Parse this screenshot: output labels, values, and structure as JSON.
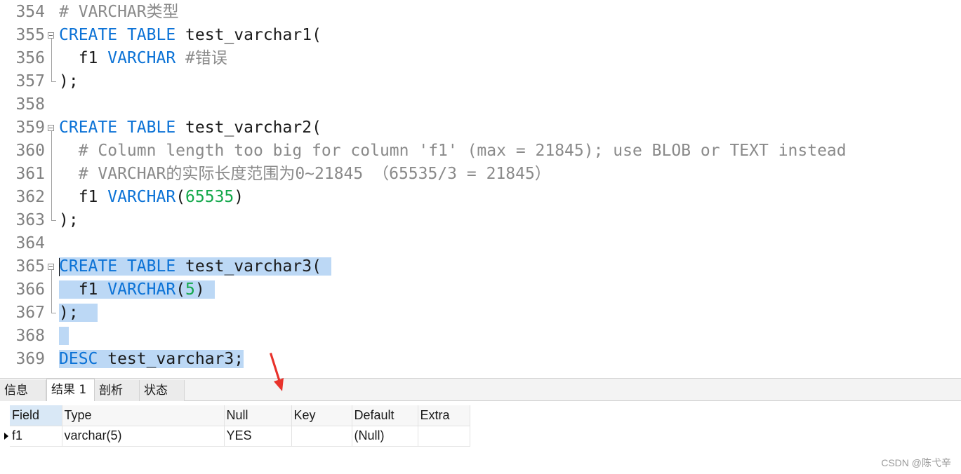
{
  "editor": {
    "lines": [
      {
        "num": "354",
        "parts": [
          {
            "t": "# VARCHAR类型",
            "c": "cm"
          }
        ]
      },
      {
        "num": "355",
        "parts": [
          {
            "t": "CREATE",
            "c": "kw"
          },
          {
            "t": " "
          },
          {
            "t": "TABLE",
            "c": "kw"
          },
          {
            "t": " test_varchar1("
          }
        ]
      },
      {
        "num": "356",
        "parts": [
          {
            "t": "  f1 "
          },
          {
            "t": "VARCHAR",
            "c": "kw"
          },
          {
            "t": " #错误",
            "c": "cm"
          }
        ]
      },
      {
        "num": "357",
        "parts": [
          {
            "t": ");"
          }
        ]
      },
      {
        "num": "358",
        "parts": []
      },
      {
        "num": "359",
        "parts": [
          {
            "t": "CREATE",
            "c": "kw"
          },
          {
            "t": " "
          },
          {
            "t": "TABLE",
            "c": "kw"
          },
          {
            "t": " test_varchar2("
          }
        ]
      },
      {
        "num": "360",
        "parts": [
          {
            "t": "  # Column length too big for column 'f1' (max = 21845); use BLOB or TEXT instead",
            "c": "cm"
          }
        ]
      },
      {
        "num": "361",
        "parts": [
          {
            "t": "  # VARCHAR的实际长度范围为0~21845 （65535/3 = 21845）",
            "c": "cm"
          }
        ]
      },
      {
        "num": "362",
        "parts": [
          {
            "t": "  f1 "
          },
          {
            "t": "VARCHAR",
            "c": "kw"
          },
          {
            "t": "("
          },
          {
            "t": "65535",
            "c": "nm"
          },
          {
            "t": ")"
          }
        ]
      },
      {
        "num": "363",
        "parts": [
          {
            "t": ");"
          }
        ]
      },
      {
        "num": "364",
        "parts": []
      },
      {
        "num": "365",
        "parts": [
          {
            "t": "CREATE",
            "c": "kw"
          },
          {
            "t": " "
          },
          {
            "t": "TABLE",
            "c": "kw"
          },
          {
            "t": " test_varchar3( "
          }
        ],
        "selected": true
      },
      {
        "num": "366",
        "parts": [
          {
            "t": "  f1 "
          },
          {
            "t": "VARCHAR",
            "c": "kw"
          },
          {
            "t": "("
          },
          {
            "t": "5",
            "c": "nm"
          },
          {
            "t": ") "
          }
        ],
        "selected": true
      },
      {
        "num": "367",
        "parts": [
          {
            "t": ");  "
          }
        ],
        "selected": true
      },
      {
        "num": "368",
        "parts": [
          {
            "t": " "
          }
        ],
        "selected": true
      },
      {
        "num": "369",
        "parts": [
          {
            "t": "DESC",
            "c": "kw"
          },
          {
            "t": " test_varchar3;"
          }
        ],
        "selected": true
      }
    ]
  },
  "tabs": [
    {
      "label": "信息",
      "active": false
    },
    {
      "label": "结果 1",
      "active": true
    },
    {
      "label": "剖析",
      "active": false
    },
    {
      "label": "状态",
      "active": false
    }
  ],
  "result": {
    "columns": [
      "Field",
      "Type",
      "Null",
      "Key",
      "Default",
      "Extra"
    ],
    "rows": [
      [
        "f1",
        "varchar(5)",
        "YES",
        "",
        "(Null)",
        ""
      ]
    ]
  },
  "watermark": "CSDN @陈弋辛",
  "colors": {
    "keyword": "#0b72d6",
    "comment": "#8a8a8a",
    "number": "#13a84b",
    "selection": "#bcd8f5",
    "arrow": "#e8322b"
  }
}
